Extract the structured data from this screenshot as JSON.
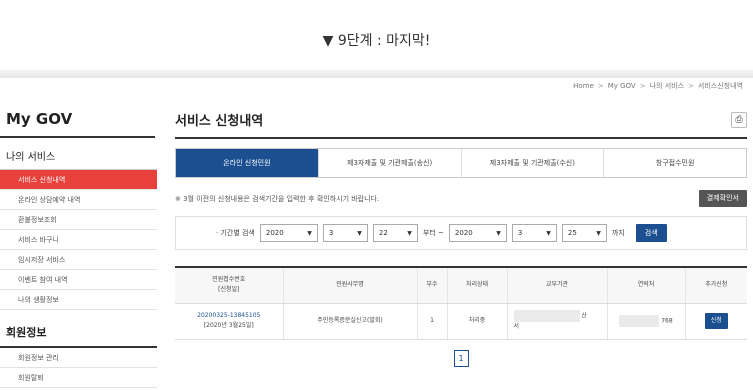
{
  "step_caption": "▼ 9단계 : 마지막!",
  "breadcrumb": [
    "Home",
    "My GOV",
    "나의 서비스",
    "서비스신청내역"
  ],
  "breadcrumb_sep": ">",
  "sidebar": {
    "title": "My GOV",
    "groups": [
      {
        "title": "나의 서비스",
        "items": [
          "서비스 신청내역",
          "온라인 상담예약 내역",
          "환불정보조회",
          "서비스 바구니",
          "임시저장 서비스",
          "이벤트 참여 내역",
          "나의 생활정보"
        ],
        "active_index": 0
      },
      {
        "title": "회원정보",
        "items": [
          "회원정보 관리",
          "회원탈퇴"
        ]
      }
    ]
  },
  "main": {
    "title": "서비스 신청내역",
    "print_icon": "printer-icon",
    "tabs": [
      "온라인 신청민원",
      "제3자제출 및 기관제출(송신)",
      "제3자제출 및 기관제출(수신)",
      "창구접수민원"
    ],
    "active_tab": 0,
    "notice": "※ 3월 이전의 신청내용은 검색기간을 입력한 후 확인하시기 바랍니다.",
    "payment_confirm_label": "결제확인서",
    "search": {
      "label": "· 기간별 검색",
      "from_year": "2020",
      "from_month": "3",
      "from_day": "22",
      "from_suffix": "부터 ~",
      "to_year": "2020",
      "to_month": "3",
      "to_day": "25",
      "to_suffix": "까지",
      "button": "검색"
    },
    "table": {
      "headers": [
        "민원접수번호\n[신청일]",
        "민원사무명",
        "부수",
        "처리상태",
        "교부기관",
        "연락처",
        "추가신청"
      ],
      "rows": [
        {
          "receipt_no": "20200325-13845105",
          "date": "[2020년 3월25일]",
          "service": "주민등록증분실신고(발회)",
          "copies": "1",
          "status": "처리중",
          "agency_partial": "산",
          "agency_partial2": "서",
          "contact_partial": "768",
          "action": "신청"
        }
      ]
    },
    "pager": [
      "1"
    ]
  },
  "colors": {
    "active_sidebar": "#e8413b",
    "primary_blue": "#1b4f8f",
    "dark_button": "#555555"
  }
}
